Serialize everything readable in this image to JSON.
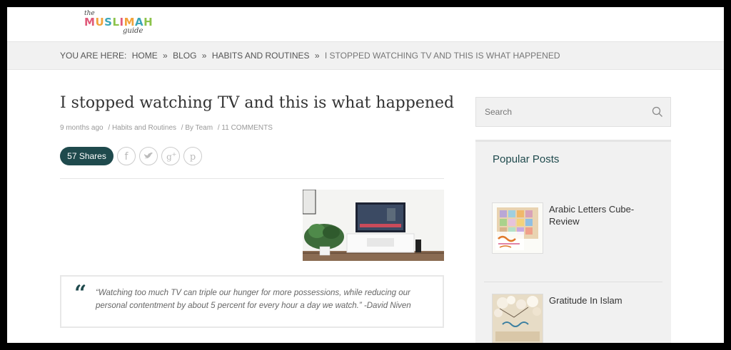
{
  "logo": {
    "the": "the",
    "word": "MUSLIMAH",
    "guide": "guide",
    "letter_colors": [
      "#e05a7a",
      "#f2a33a",
      "#3aa6b8",
      "#8bc34a",
      "#e05a7a",
      "#f2a33a",
      "#3aa6b8",
      "#8bc34a"
    ]
  },
  "breadcrumb": {
    "prefix": "YOU ARE HERE:",
    "items": [
      "HOME",
      "BLOG",
      "HABITS AND ROUTINES"
    ],
    "separator": "»",
    "current": "I STOPPED WATCHING TV AND THIS IS WHAT HAPPENED"
  },
  "post": {
    "title": "I stopped watching TV and this is what happened",
    "meta": {
      "date": "9 months ago",
      "category": "/ Habits and Routines",
      "author": "/ By Team",
      "comments": "/ 11 COMMENTS"
    },
    "shares_label": "57 Shares",
    "social_icons": [
      "facebook-icon",
      "twitter-icon",
      "google-plus-icon",
      "pinterest-icon"
    ],
    "quote": "“Watching too much TV can triple our hunger for more possessions, while reducing our personal contentment by about 5 percent for every hour a day we watch.”  -David Niven"
  },
  "sidebar": {
    "search_placeholder": "Search",
    "popular_heading": "Popular Posts",
    "popular_posts": [
      {
        "title": "Arabic Letters Cube-Review"
      },
      {
        "title": "Gratitude In Islam"
      }
    ]
  },
  "colors": {
    "accent": "#1f4a4d",
    "breadcrumb_bg": "#f1f1f1"
  }
}
